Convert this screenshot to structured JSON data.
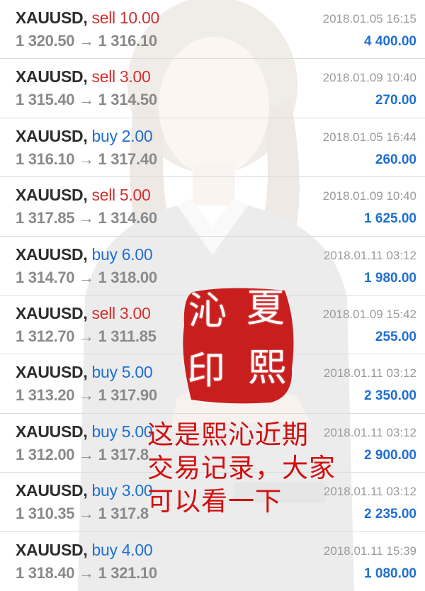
{
  "trades": [
    {
      "symbol": "XAUUSD,",
      "direction": "sell 10.00",
      "side": "sell",
      "prices": "1 320.50 → 1 316.10",
      "date": "2018.01.05 16:15",
      "profit": "4 400.00"
    },
    {
      "symbol": "XAUUSD,",
      "direction": "sell 3.00",
      "side": "sell",
      "prices": "1 315.40 → 1 314.50",
      "date": "2018.01.09 10:40",
      "profit": "270.00"
    },
    {
      "symbol": "XAUUSD,",
      "direction": "buy 2.00",
      "side": "buy",
      "prices": "1 316.10 → 1 317.40",
      "date": "2018.01.05 16:44",
      "profit": "260.00"
    },
    {
      "symbol": "XAUUSD,",
      "direction": "sell 5.00",
      "side": "sell",
      "prices": "1 317.85 → 1 314.60",
      "date": "2018.01.09 10:40",
      "profit": "1 625.00"
    },
    {
      "symbol": "XAUUSD,",
      "direction": "buy 6.00",
      "side": "buy",
      "prices": "1 314.70 → 1 318.00",
      "date": "2018.01.11 03:12",
      "profit": "1 980.00"
    },
    {
      "symbol": "XAUUSD,",
      "direction": "sell 3.00",
      "side": "sell",
      "prices": "1 312.70 → 1 311.85",
      "date": "2018.01.09 15:42",
      "profit": "255.00"
    },
    {
      "symbol": "XAUUSD,",
      "direction": "buy 5.00",
      "side": "buy",
      "prices": "1 313.20 → 1 317.90",
      "date": "2018.01.11 03:12",
      "profit": "2 350.00"
    },
    {
      "symbol": "XAUUSD,",
      "direction": "buy 5.00",
      "side": "buy",
      "prices": "1 312.00 → 1 317.8",
      "date": "2018.01.11 03:12",
      "profit": "2 900.00"
    },
    {
      "symbol": "XAUUSD,",
      "direction": "buy 3.00",
      "side": "buy",
      "prices": "1 310.35 → 1 317.8",
      "date": "2018.01.11 03:12",
      "profit": "2 235.00"
    },
    {
      "symbol": "XAUUSD,",
      "direction": "buy 4.00",
      "side": "buy",
      "prices": "1 318.40 → 1 321.10",
      "date": "2018.01.11 15:39",
      "profit": "1 080.00"
    }
  ],
  "seal": {
    "chars": [
      "沁",
      "夏",
      "印",
      "熙"
    ],
    "color": "#c81e1e"
  },
  "overlay": {
    "lines": [
      "这是熙沁近期",
      "交易记录，大家",
      "可以看一下"
    ]
  },
  "colors": {
    "sell": "#d32f2f",
    "buy": "#1f6fd1",
    "profit": "#1f6fd1"
  }
}
